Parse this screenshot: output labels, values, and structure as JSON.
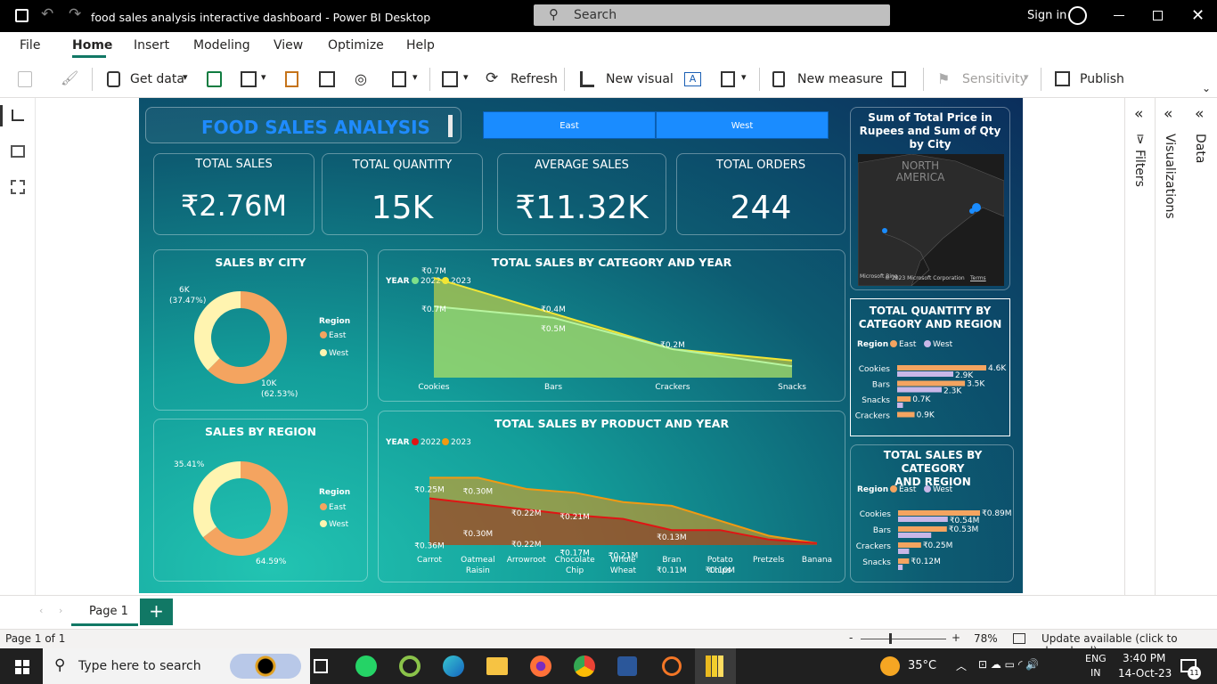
{
  "titlebar": {
    "title": "food sales analysis interactive dashboard - Power BI Desktop",
    "search": "Search",
    "sign_in": "Sign in"
  },
  "menu": [
    "File",
    "Home",
    "Insert",
    "Modeling",
    "View",
    "Optimize",
    "Help"
  ],
  "ribbon": {
    "get_data": "Get data",
    "refresh": "Refresh",
    "new_visual": "New visual",
    "new_measure": "New measure",
    "sensitivity": "Sensitivity",
    "publish": "Publish"
  },
  "report": {
    "title": "FOOD SALES ANALYSIS",
    "slicer": [
      "East",
      "West"
    ],
    "kpis": [
      {
        "label": "TOTAL SALES",
        "value": "₹2.76M"
      },
      {
        "label": "TOTAL QUANTITY",
        "value": "15K"
      },
      {
        "label": "AVERAGE SALES",
        "value": "₹11.32K"
      },
      {
        "label": "TOTAL ORDERS",
        "value": "244"
      }
    ],
    "map": {
      "title": "Sum of Total Price in Rupees and Sum of Qty by City",
      "label": "NORTH AMERICA",
      "credit": "© 2023 Microsoft Corporation",
      "terms": "Terms",
      "brand": "Microsoft Bing"
    },
    "city": {
      "title": "SALES BY CITY",
      "legend_title": "Region",
      "legend": [
        "East",
        "West"
      ],
      "label_west_v": "6K",
      "label_west_p": "(37.47%)",
      "label_east_v": "10K",
      "label_east_p": "(62.53%)"
    },
    "region": {
      "title": "SALES BY REGION",
      "legend_title": "Region",
      "legend": [
        "East",
        "West"
      ],
      "label_west": "35.41%",
      "label_east": "64.59%"
    },
    "cat_year": {
      "title": "TOTAL SALES BY CATEGORY AND YEAR",
      "legend_title": "YEAR",
      "legend": [
        "2022",
        "2023"
      ],
      "categories": [
        "Cookies",
        "Bars",
        "Crackers",
        "Snacks"
      ],
      "labels_2023": [
        "₹0.7M",
        "₹0.4M",
        "₹0.2M",
        ""
      ],
      "labels_2022": [
        "₹0.7M",
        "₹0.5M",
        "",
        ""
      ]
    },
    "prod_year": {
      "title": "TOTAL SALES BY PRODUCT AND YEAR",
      "legend_title": "YEAR",
      "legend": [
        "2022",
        "2023"
      ],
      "categories": [
        [
          "Carrot",
          ""
        ],
        [
          "Oatmeal",
          "Raisin"
        ],
        [
          "Arrowroot",
          ""
        ],
        [
          "Chocolate",
          "Chip"
        ],
        [
          "Whole",
          "Wheat"
        ],
        [
          "Bran",
          ""
        ],
        [
          "Potato",
          "Chips"
        ],
        [
          "Pretzels",
          ""
        ],
        [
          "Banana",
          ""
        ]
      ],
      "labels_2023": [
        "₹0.25M",
        "₹0.30M",
        "₹0.22M",
        "₹0.21M",
        "",
        "₹0.13M",
        "",
        "",
        ""
      ],
      "labels_2022": [
        "₹0.36M",
        "₹0.30M",
        "₹0.22M",
        "₹0.17M",
        "₹0.21M",
        "₹0.11M",
        "₹0.10M",
        "",
        ""
      ]
    },
    "qty_cat": {
      "title_1": "TOTAL QUANTITY BY",
      "title_2": "CATEGORY AND REGION",
      "legend_title": "Region",
      "legend": [
        "East",
        "West"
      ],
      "rows": [
        {
          "cat": "Cookies",
          "east": "4.6K",
          "west": "2.9K"
        },
        {
          "cat": "Bars",
          "east": "3.5K",
          "west": "2.3K"
        },
        {
          "cat": "Snacks",
          "east": "0.7K",
          "west": ""
        },
        {
          "cat": "Crackers",
          "east": "0.9K",
          "west": ""
        }
      ]
    },
    "sales_cat": {
      "title_1": "TOTAL SALES BY CATEGORY",
      "title_2": "AND REGION",
      "legend_title": "Region",
      "legend": [
        "East",
        "West"
      ],
      "rows": [
        {
          "cat": "Cookies",
          "east": "₹0.89M",
          "west": "₹0.54M"
        },
        {
          "cat": "Bars",
          "east": "₹0.53M",
          "west": ""
        },
        {
          "cat": "Crackers",
          "east": "₹0.25M",
          "west": ""
        },
        {
          "cat": "Snacks",
          "east": "₹0.12M",
          "west": ""
        }
      ]
    }
  },
  "panes": {
    "filters": "Filters",
    "visualizations": "Visualizations",
    "data": "Data"
  },
  "pages": {
    "tab": "Page 1",
    "add": "+"
  },
  "status": {
    "page": "Page 1 of 1",
    "zoom": "78%",
    "update": "Update available (click to download)"
  },
  "taskbar": {
    "search": "Type here to search",
    "temp": "35°C",
    "lang1": "ENG",
    "lang2": "IN",
    "time": "3:40 PM",
    "date": "14-Oct-23",
    "notif": "11"
  },
  "colors": {
    "east": "#f4a460",
    "west": "#c9b7e8",
    "y2022_cat": "#7ee08a",
    "y2023_cat": "#f2e635",
    "y2022_prod": "#e01414",
    "y2023_prod": "#f29a12",
    "slicer": "#1a8cff",
    "title_blue": "#1f8bff"
  },
  "chart_data": [
    {
      "type": "pie",
      "title": "SALES BY CITY",
      "categories": [
        "East",
        "West"
      ],
      "values": [
        10000,
        6000
      ],
      "percent": [
        62.53,
        37.47
      ]
    },
    {
      "type": "pie",
      "title": "SALES BY REGION",
      "categories": [
        "East",
        "West"
      ],
      "percent": [
        64.59,
        35.41
      ]
    },
    {
      "type": "area",
      "title": "TOTAL SALES BY CATEGORY AND YEAR",
      "categories": [
        "Cookies",
        "Bars",
        "Crackers",
        "Snacks"
      ],
      "series": [
        {
          "name": "2022",
          "values": [
            0.5,
            0.42,
            0.2,
            0.08
          ]
        },
        {
          "name": "2023",
          "values": [
            0.7,
            0.45,
            0.2,
            0.12
          ]
        }
      ],
      "ylabel": "₹M"
    },
    {
      "type": "area",
      "title": "TOTAL SALES BY PRODUCT AND YEAR",
      "categories": [
        "Carrot",
        "Oatmeal Raisin",
        "Arrowroot",
        "Chocolate Chip",
        "Whole Wheat",
        "Bran",
        "Potato Chips",
        "Pretzels",
        "Banana"
      ],
      "series": [
        {
          "name": "2022",
          "values": [
            0.25,
            0.22,
            0.19,
            0.16,
            0.14,
            0.08,
            0.08,
            0.03,
            0.01
          ]
        },
        {
          "name": "2023",
          "values": [
            0.36,
            0.36,
            0.3,
            0.28,
            0.23,
            0.21,
            0.13,
            0.05,
            0.01
          ]
        }
      ],
      "ylabel": "₹M"
    },
    {
      "type": "bar",
      "title": "TOTAL QUANTITY BY CATEGORY AND REGION",
      "categories": [
        "Cookies",
        "Bars",
        "Snacks",
        "Crackers"
      ],
      "series": [
        {
          "name": "East",
          "values": [
            4.6,
            3.5,
            0.7,
            0.9
          ]
        },
        {
          "name": "West",
          "values": [
            2.9,
            2.3,
            0.3,
            0
          ]
        }
      ]
    },
    {
      "type": "bar",
      "title": "TOTAL SALES BY CATEGORY AND REGION",
      "categories": [
        "Cookies",
        "Bars",
        "Crackers",
        "Snacks"
      ],
      "series": [
        {
          "name": "East",
          "values": [
            0.89,
            0.53,
            0.25,
            0.12
          ]
        },
        {
          "name": "West",
          "values": [
            0.54,
            0.36,
            0.12,
            0.05
          ]
        }
      ]
    }
  ]
}
